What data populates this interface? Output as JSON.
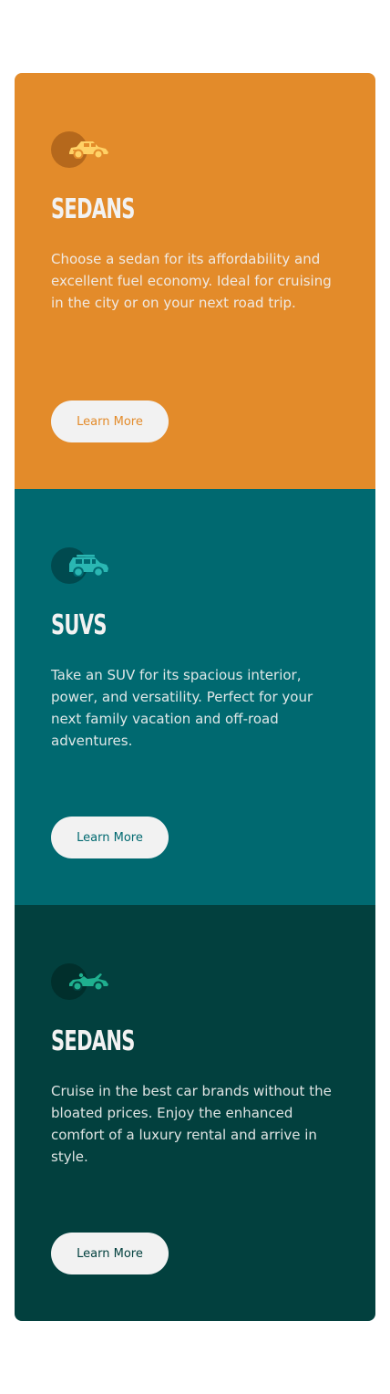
{
  "cards": [
    {
      "icon": "sedan-car-icon",
      "title": "SEDANS",
      "text": "Choose a sedan for its affordability and excellent fuel economy. Ideal for cruising in the city or on your next road trip.",
      "button_label": "Learn More",
      "bg_color": "#e38b2a"
    },
    {
      "icon": "suv-car-icon",
      "title": "SUVS",
      "text": "Take an SUV for its spacious interior, power, and versatility. Perfect for your next family vacation and off-road adventures.",
      "button_label": "Learn More",
      "bg_color": "#006970"
    },
    {
      "icon": "luxury-car-icon",
      "title": "SEDANS",
      "text": "Cruise in the best car brands without the bloated prices. Enjoy the enhanced comfort of a luxury rental and arrive in style.",
      "button_label": "Learn More",
      "bg_color": "#02403e"
    }
  ]
}
